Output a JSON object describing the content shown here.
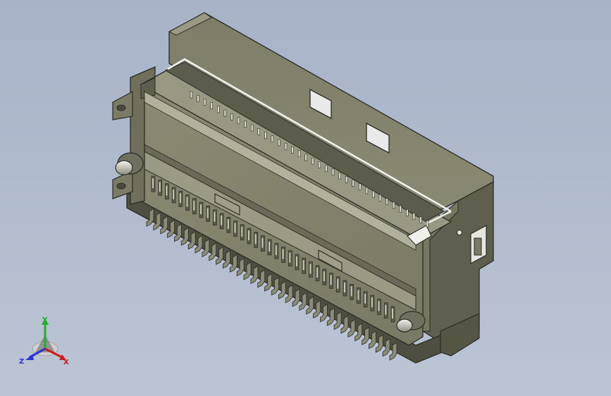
{
  "viewport": {
    "background_top": "#a7b3c8",
    "background_bottom": "#bcc5d4"
  },
  "model": {
    "body_color": "#86866f",
    "shade_color": "#5e5f4e",
    "edge_color": "#2a2b24",
    "pin_count_per_row": 36
  },
  "triad": {
    "x_label": "X",
    "y_label": "Y",
    "z_label": "Z",
    "x_color": "#d11a1a",
    "y_color": "#22b02a",
    "z_color": "#2a34d6"
  }
}
